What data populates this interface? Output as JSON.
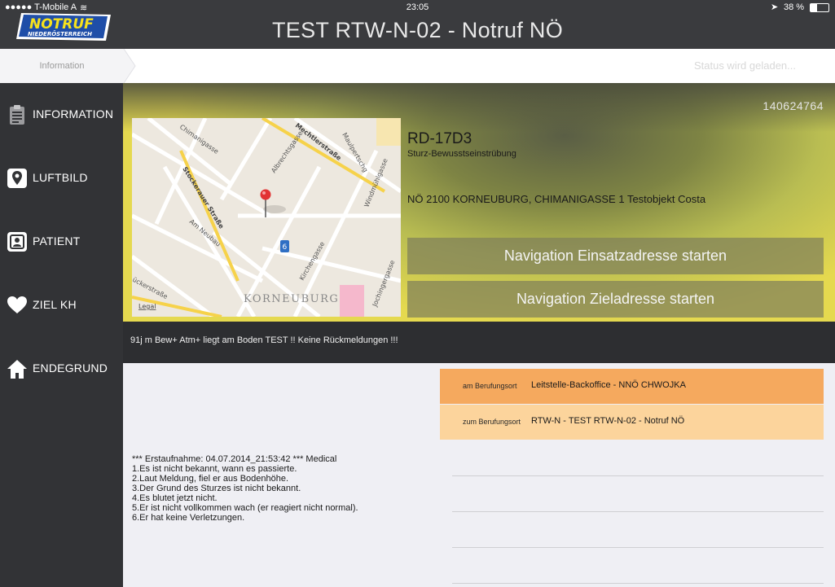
{
  "status_bar": {
    "carrier": "●●●●● T-Mobile A",
    "time": "23:05",
    "battery": "38 %"
  },
  "header": {
    "logo_top": "NOTRUF",
    "logo_bottom": "NIEDERÖSTERREICH",
    "title": "TEST RTW-N-02 - Notruf NÖ"
  },
  "info_bar": {
    "crumb": "Information",
    "status": "Status wird geladen..."
  },
  "sidebar": {
    "items": [
      {
        "label": "INFORMATION",
        "icon": "clipboard-icon"
      },
      {
        "label": "LUFTBILD",
        "icon": "map-pin-icon"
      },
      {
        "label": "PATIENT",
        "icon": "patient-icon"
      },
      {
        "label": "ZIEL KH",
        "icon": "heart-icon"
      },
      {
        "label": "ENDEGRUND",
        "icon": "home-icon"
      }
    ]
  },
  "incident": {
    "number": "140624764",
    "code": "RD-17D3",
    "description": "Sturz-Bewusstseinstrübung",
    "address": "NÖ 2100 KORNEUBURG, CHIMANIGASSE 1  Testobjekt Costa"
  },
  "map": {
    "streets": [
      "Chimanigasse",
      "Mechtlerstraße",
      "Maulpertschg",
      "Albrechtsgasse",
      "Stockerauer Straße",
      "Windmühlgasse",
      "Am Neubau",
      "Kirchengasse",
      "Jochingergasse",
      "ückerstraße"
    ],
    "town": "KORNEUBURG",
    "legal": "Legal",
    "route_number": "6"
  },
  "navigation": {
    "incident_address_label": "Navigation Einsatzadresse starten",
    "target_address_label": "Navigation Zieladresse starten"
  },
  "notes": "91j m Bew+ Atm+ liegt am Boden TEST !! Keine Rückmeldungen !!!",
  "calls": [
    {
      "prefix": "am Berufungsort",
      "text": "Leitstelle-Backoffice - NNÖ CHWOJKA",
      "color": "#f5a95e"
    },
    {
      "prefix": "zum Berufungsort",
      "text": "RTW-N - TEST RTW-N-02 - Notruf NÖ",
      "color": "#fcd49c"
    }
  ],
  "protocol": [
    "*** Erstaufnahme: 04.07.2014_21:53:42 *** Medical",
    "1.Es ist nicht bekannt, wann es passierte.",
    "2.Laut Meldung, fiel er aus Bodenhöhe.",
    "3.Der Grund des Sturzes ist nicht bekannt.",
    "4.Es blutet jetzt nicht.",
    "5.Er ist nicht vollkommen wach (er reagiert nicht normal).",
    "6.Er hat keine Verletzungen."
  ]
}
